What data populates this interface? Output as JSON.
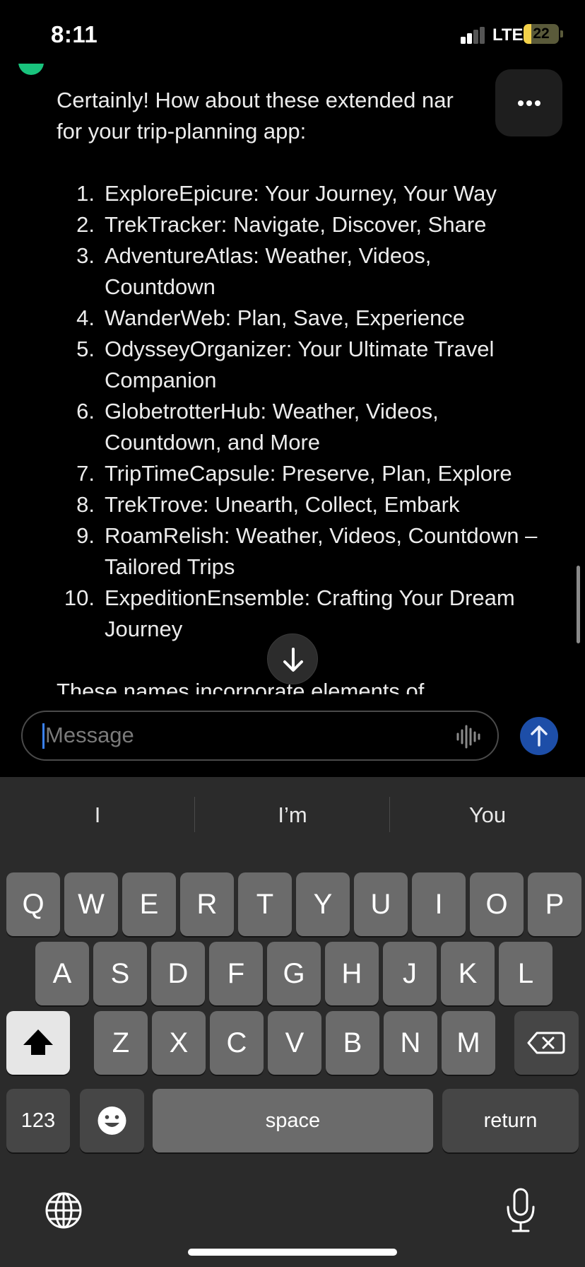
{
  "status_bar": {
    "time": "8:11",
    "network": "LTE",
    "battery": "22",
    "battery_level": 0.22,
    "battery_color": "#f4d24a",
    "signal_bars_active": 2
  },
  "chat": {
    "intro": "Certainly! How about these extended nar\nfor your trip-planning app:",
    "names": [
      {
        "num": "1.",
        "text": "ExploreEpicure: Your Journey, Your Way"
      },
      {
        "num": "2.",
        "text": "TrekTracker: Navigate, Discover, Share"
      },
      {
        "num": "3.",
        "text": "AdventureAtlas: Weather, Videos, Countdown"
      },
      {
        "num": "4.",
        "text": "WanderWeb: Plan, Save, Experience"
      },
      {
        "num": "5.",
        "text": "OdysseyOrganizer: Your Ultimate Travel Companion"
      },
      {
        "num": "6.",
        "text": "GlobetrotterHub: Weather, Videos, Countdown, and More"
      },
      {
        "num": "7.",
        "text": "TripTimeCapsule: Preserve, Plan, Explore"
      },
      {
        "num": "8.",
        "text": "TrekTrove: Unearth, Collect, Embark"
      },
      {
        "num": "9.",
        "text": "RoamRelish: Weather, Videos, Countdown – Tailored Trips"
      },
      {
        "num": "10.",
        "text": "ExpeditionEnsemble: Crafting Your Dream Journey"
      }
    ],
    "closing_partial": "These names incorporate elements of"
  },
  "composer": {
    "placeholder": "Message",
    "accent_color": "#3a82f7",
    "send_color": "#1d4ea8"
  },
  "keyboard": {
    "suggestions": [
      "I",
      "I’m",
      "You"
    ],
    "row1": [
      "Q",
      "W",
      "E",
      "R",
      "T",
      "Y",
      "U",
      "I",
      "O",
      "P"
    ],
    "row2": [
      "A",
      "S",
      "D",
      "F",
      "G",
      "H",
      "J",
      "K",
      "L"
    ],
    "row3": [
      "Z",
      "X",
      "C",
      "V",
      "B",
      "N",
      "M"
    ],
    "numbers_label": "123",
    "space_label": "space",
    "return_label": "return"
  },
  "icons": [
    "more-icon",
    "arrow-down-icon",
    "voice-waveform-icon",
    "arrow-up-icon",
    "shift-icon",
    "backspace-icon",
    "emoji-icon",
    "globe-icon",
    "microphone-icon"
  ]
}
